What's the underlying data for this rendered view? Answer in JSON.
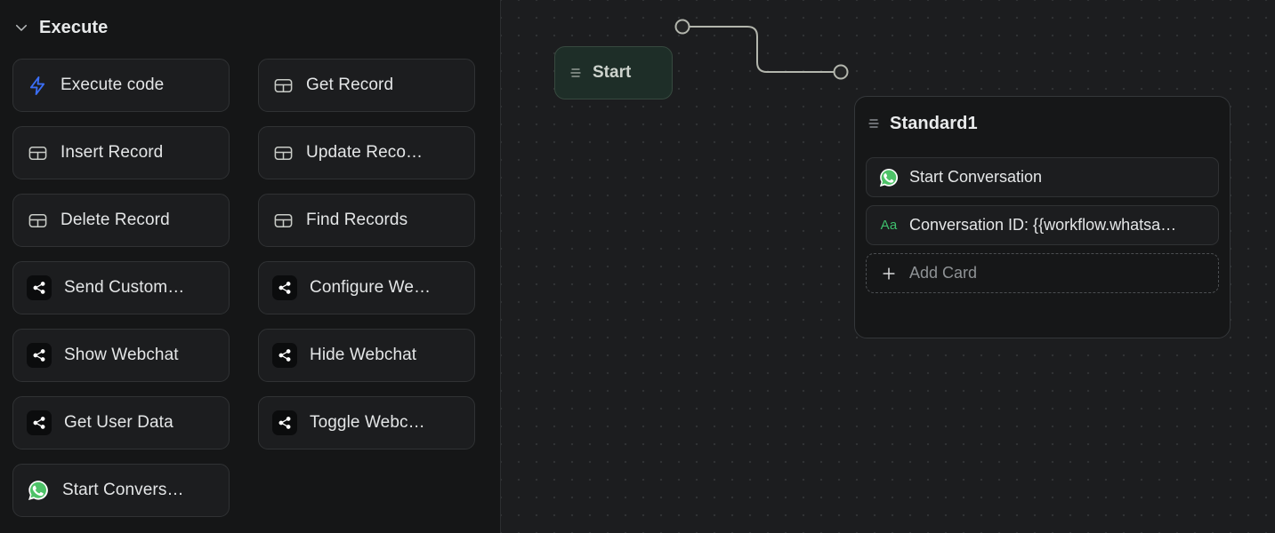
{
  "sidebar": {
    "section": {
      "title": "Execute",
      "chevron_icon": "chevron-down-icon",
      "expanded": true
    },
    "items": [
      {
        "label": "Execute code",
        "icon": "zap-icon",
        "icon_color": "#3b6ef6",
        "column": "left",
        "truncated": false
      },
      {
        "label": "Get Record",
        "icon": "table-icon",
        "icon_color": "#c9ccc7",
        "column": "right",
        "truncated": false
      },
      {
        "label": "Insert Record",
        "icon": "table-icon",
        "icon_color": "#c9ccc7",
        "column": "left",
        "truncated": false
      },
      {
        "label": "Update Reco…",
        "icon": "table-icon",
        "icon_color": "#c9ccc7",
        "column": "right",
        "truncated": true
      },
      {
        "label": "Delete Record",
        "icon": "table-icon",
        "icon_color": "#c9ccc7",
        "column": "left",
        "truncated": false
      },
      {
        "label": "Find Records",
        "icon": "table-icon",
        "icon_color": "#c9ccc7",
        "column": "right",
        "truncated": false
      },
      {
        "label": "Send Custom…",
        "icon": "share-icon",
        "icon_color": "#ffffff",
        "column": "left",
        "truncated": true
      },
      {
        "label": "Configure We…",
        "icon": "share-icon",
        "icon_color": "#ffffff",
        "column": "right",
        "truncated": true
      },
      {
        "label": "Show Webchat",
        "icon": "share-icon",
        "icon_color": "#ffffff",
        "column": "left",
        "truncated": false
      },
      {
        "label": "Hide Webchat",
        "icon": "share-icon",
        "icon_color": "#ffffff",
        "column": "right",
        "truncated": false
      },
      {
        "label": "Get User Data",
        "icon": "share-icon",
        "icon_color": "#ffffff",
        "column": "left",
        "truncated": false
      },
      {
        "label": "Toggle Webc…",
        "icon": "share-icon",
        "icon_color": "#ffffff",
        "column": "right",
        "truncated": true
      },
      {
        "label": "Start Convers…",
        "icon": "whatsapp-icon",
        "icon_color": "#4ec268",
        "column": "left",
        "truncated": true
      }
    ]
  },
  "canvas": {
    "background_color": "#1c1d1f",
    "grid_dot_color": "#303234",
    "grid_spacing": 20,
    "nodes": [
      {
        "id": "start",
        "title": "Start",
        "handle_icon": "drag-handle-icon",
        "accent_color": "#1e2e28",
        "border_color": "#37493f"
      },
      {
        "id": "standard1",
        "title": "Standard1",
        "handle_icon": "drag-handle-icon",
        "cards": [
          {
            "label": "Start Conversation",
            "icon": "whatsapp-icon",
            "icon_color": "#4ec268"
          },
          {
            "label": "Conversation ID: {{workflow.whatsa…",
            "icon": "text-aa-icon",
            "icon_color": "#3fbf6d"
          }
        ],
        "add_card": {
          "label": "Add Card",
          "icon": "plus-icon"
        }
      }
    ],
    "edges": [
      {
        "from": "start",
        "to": "standard1",
        "color": "#b3b6ad",
        "style": "orthogonal-rounded"
      }
    ]
  }
}
